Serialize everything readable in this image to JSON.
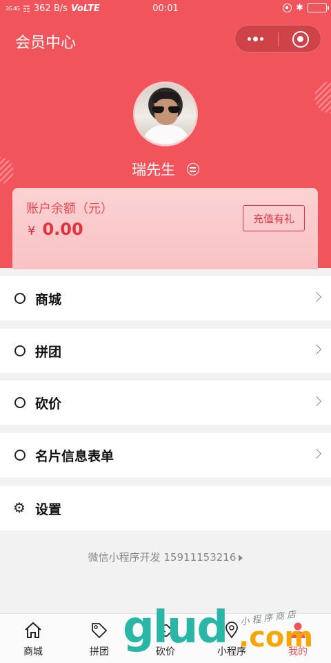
{
  "status_bar": {
    "signal": "2G 4G",
    "speed": "362 B/s",
    "network": "VoLTE",
    "time": "00:01"
  },
  "nav": {
    "title": "会员中心"
  },
  "user": {
    "name": "瑞先生"
  },
  "balance": {
    "label": "账户余额（元）",
    "currency": "¥",
    "amount": "0.00",
    "recharge_label": "充值有礼"
  },
  "menu": [
    {
      "label": "商城",
      "icon": "circle-icon"
    },
    {
      "label": "拼团",
      "icon": "circle-icon"
    },
    {
      "label": "砍价",
      "icon": "circle-icon"
    },
    {
      "label": "名片信息表单",
      "icon": "circle-icon"
    },
    {
      "label": "设置",
      "icon": "gear-icon"
    }
  ],
  "footer": {
    "text": "微信小程序开发 15911153216"
  },
  "tabbar": [
    {
      "label": "商城",
      "icon": "home-icon"
    },
    {
      "label": "拼团",
      "icon": "tag-icon"
    },
    {
      "label": "砍价",
      "icon": "cut-tag-icon"
    },
    {
      "label": "小程序",
      "icon": "location-icon"
    },
    {
      "label": "我的",
      "icon": "user-icon",
      "active": true
    }
  ],
  "watermark": {
    "brand": "glud",
    "tld": ".com",
    "sub": "小程序商店"
  },
  "colors": {
    "brand": "#f2545b",
    "accent_text": "#e3323b",
    "card_bg": "#fbd2d3"
  }
}
